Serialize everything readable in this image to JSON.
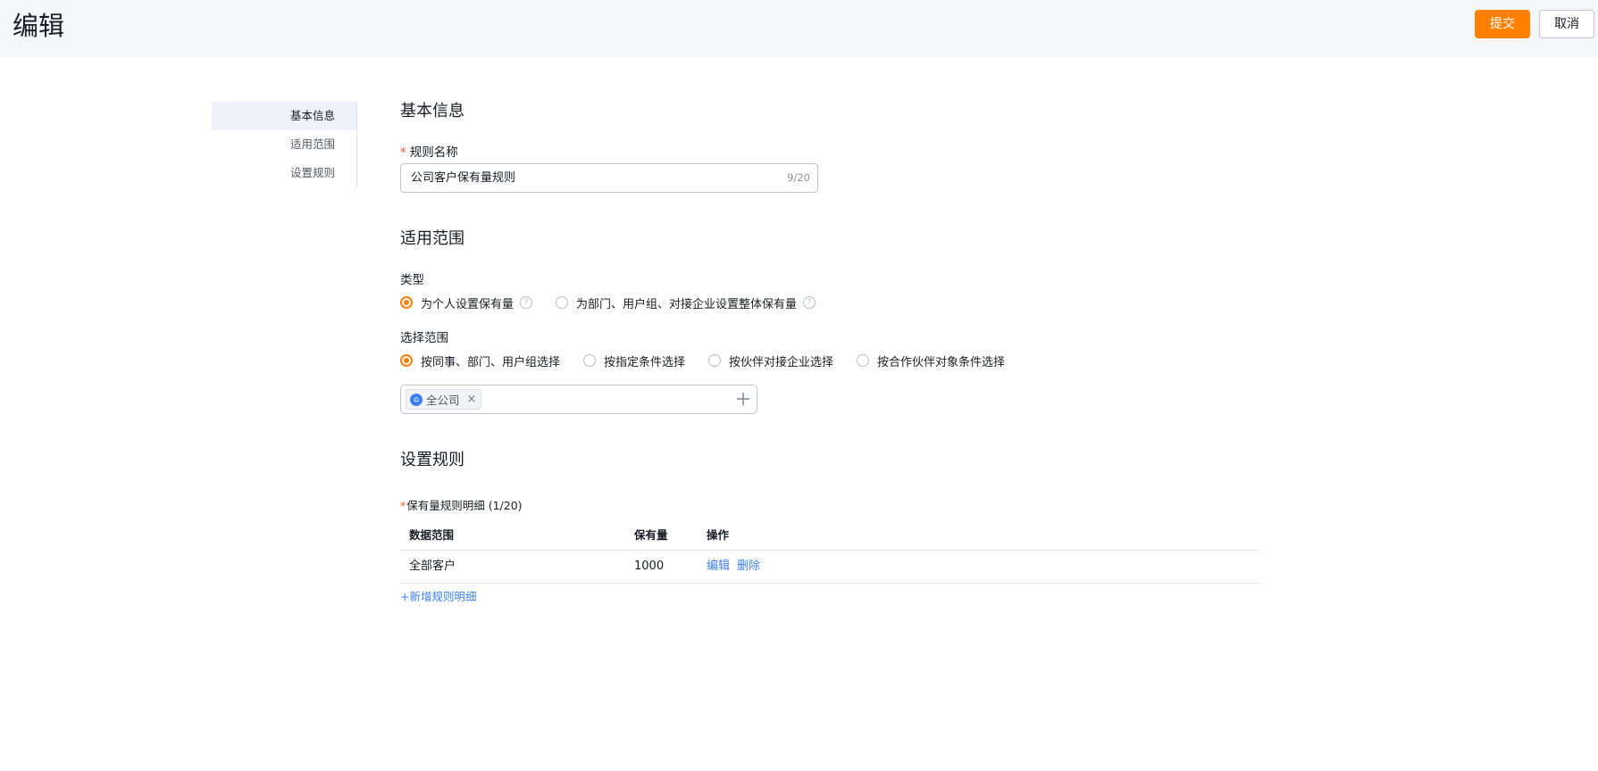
{
  "header": {
    "title": "编辑",
    "submit_label": "提交",
    "cancel_label": "取消"
  },
  "nav": {
    "items": [
      {
        "label": "基本信息",
        "active": true
      },
      {
        "label": "适用范围",
        "active": false
      },
      {
        "label": "设置规则",
        "active": false
      }
    ]
  },
  "basic": {
    "section_title": "基本信息",
    "name_label": "规则名称",
    "name_value": "公司客户保有量规则",
    "name_count": "9/20"
  },
  "scope": {
    "section_title": "适用范围",
    "type_label": "类型",
    "type_options": [
      {
        "label": "为个人设置保有量",
        "checked": true
      },
      {
        "label": "为部门、用户组、对接企业设置整体保有量",
        "checked": false
      }
    ],
    "range_label": "选择范围",
    "range_options": [
      {
        "label": "按同事、部门、用户组选择",
        "checked": true
      },
      {
        "label": "按指定条件选择",
        "checked": false
      },
      {
        "label": "按伙伴对接企业选择",
        "checked": false
      },
      {
        "label": "按合作伙伴对象条件选择",
        "checked": false
      }
    ],
    "selected_tag": "全公司"
  },
  "rules": {
    "section_title": "设置规则",
    "detail_label": "保有量规则明细 (1/20)",
    "columns": [
      "数据范围",
      "保有量",
      "操作"
    ],
    "rows": [
      {
        "range": "全部客户",
        "amount": "1000",
        "edit": "编辑",
        "delete": "删除"
      }
    ],
    "add_label": "+新增规则明细"
  },
  "colors": {
    "primary": "#ff8000",
    "link": "#3d7ff7",
    "required": "#ff522a"
  }
}
